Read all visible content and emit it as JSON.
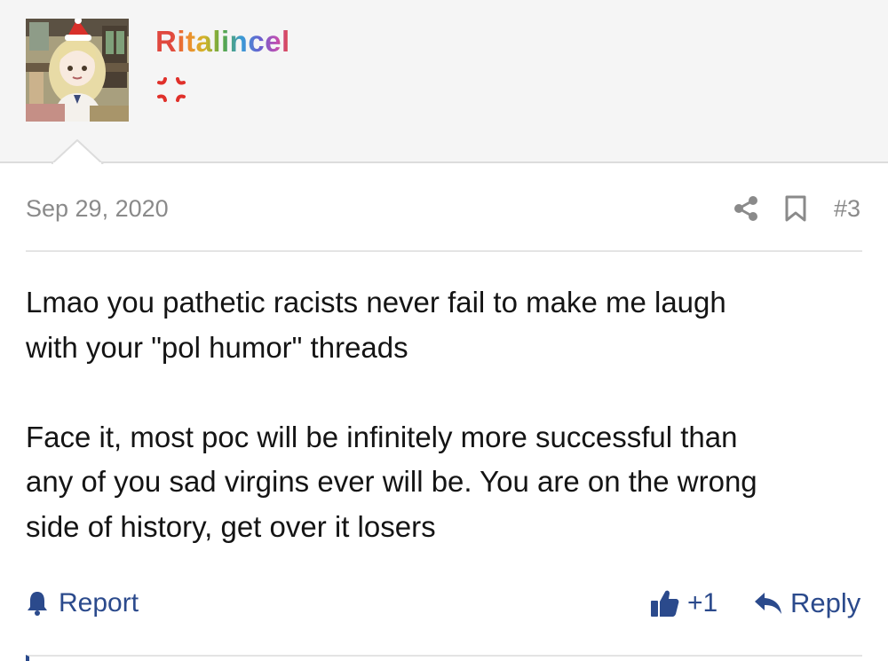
{
  "post": {
    "author": {
      "username": "Ritalincel",
      "status_icon": "anger-symbol-icon",
      "avatar": "anime-character-avatar"
    },
    "date": "Sep 29, 2020",
    "post_number": "#3",
    "body": {
      "paragraph_1_line_1": "Lmao you pathetic racists never fail to make me laugh",
      "paragraph_1_line_2": "with your \"pol humor\" threads",
      "paragraph_2_line_1": "Face it, most poc will be infinitely more successful than",
      "paragraph_2_line_2": "any of you sad virgins ever will be. You are on the wrong",
      "paragraph_2_line_3": "side of history, get over it losers"
    },
    "actions": {
      "report_label": "Report",
      "like_count": "+1",
      "reply_label": "Reply"
    }
  },
  "colors": {
    "link": "#2b4a8c",
    "meta_text": "#8a8a8a",
    "body_text": "#141414",
    "header_bg": "#f5f5f5",
    "status_icon": "#e0302a"
  },
  "icons": {
    "share": "share-icon",
    "bookmark": "bookmark-icon",
    "report": "bell-icon",
    "like": "thumbs-up-icon",
    "reply": "reply-arrow-icon"
  }
}
